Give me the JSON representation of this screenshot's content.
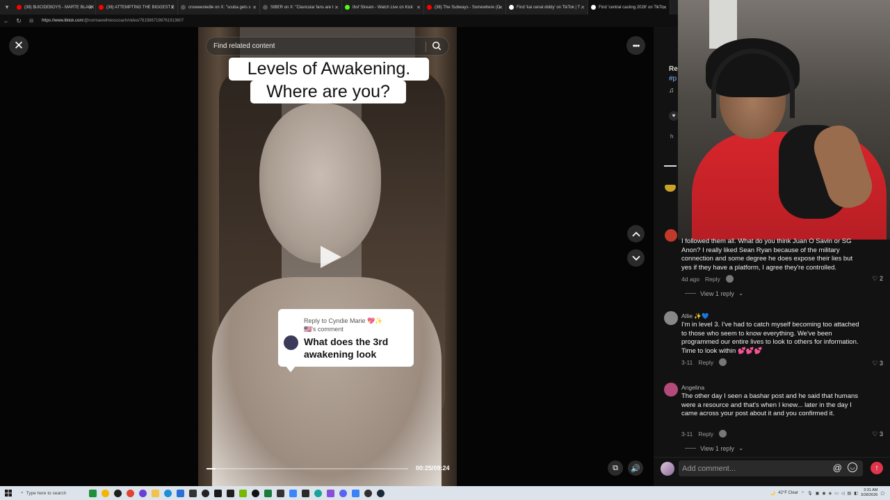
{
  "browser": {
    "tabs": [
      {
        "title": "(38) $UICIDEBOYS - MARTE BLACK",
        "color": "#ff0000"
      },
      {
        "title": "(38) ATTEMPTING THE BIGGEST E",
        "color": "#ff0000"
      },
      {
        "title": "crowwextedle on X: \"scuba gets s",
        "color": "#444444"
      },
      {
        "title": "SIBER on X: \"Clavicular fans are t",
        "color": "#444444"
      },
      {
        "title": "Ibsf Stream - Watch Live on Kick",
        "color": "#53fc18"
      },
      {
        "title": "(38) The Subways - Somewhere (O",
        "color": "#ff0000"
      },
      {
        "title": "Find 'kai cenat diddy' on TikTok | T",
        "color": "#ffffff"
      },
      {
        "title": "Find 'central casting 2026' on TikTo",
        "color": "#ffffff"
      }
    ],
    "url_domain": "https://www.tiktok.com",
    "url_path": "/@normawellnesscoach/video/7615867198761913607"
  },
  "video": {
    "search_placeholder": "Find related content",
    "title_line1": "Levels of Awakening.",
    "title_line2": "Where are you?",
    "reply_to": "Reply to Cyndie Marie 💖✨",
    "reply_to_line2": "🇺🇸's comment",
    "reply_question": "What does the 3rd awakening look",
    "time": "00:25/09:24",
    "progress_fraction": 0.044
  },
  "right_panel": {
    "partial_author": "Re",
    "partial_tag": "#p",
    "partial_music": "♫",
    "partial_h": "h"
  },
  "comments": [
    {
      "name": "",
      "text": "I followed them all. What do you think Juan O Savin or SG Anon? I really liked Sean Ryan because of the military connection and some degree he does expose their lies but yes if they have a platform, I agree they're controlled.",
      "date": "4d ago",
      "reply": "Reply",
      "likes": "2",
      "view_replies": "View 1 reply"
    },
    {
      "name": "Allie ✨💙",
      "text": "I'm in level 3. I've had to catch myself becoming too attached to those who seem to know everything. We've been programmed our entire lives to look to others for information. Time to look within 💕💕💕",
      "date": "3-11",
      "reply": "Reply",
      "likes": "3"
    },
    {
      "name": "Angelina",
      "text": "The other day I seen a bashar post and he said that humans were a resource and that's when I knew... later in the day I came across your post about it and you confirmed it.",
      "date": "3-11",
      "reply": "Reply",
      "likes": "3",
      "view_replies": "View 1 reply"
    }
  ],
  "comment_bar": {
    "placeholder": "Add comment...",
    "at": "@",
    "post": "↑"
  },
  "taskbar": {
    "search_placeholder": "Type here to search",
    "weather": "42°F Clear",
    "time": "3:31 AM",
    "date": "3/28/2026"
  },
  "colors": {
    "accent_pink": "#e0354a",
    "panel_bg": "#121212",
    "taskbar_bg": "#dde3ea"
  }
}
